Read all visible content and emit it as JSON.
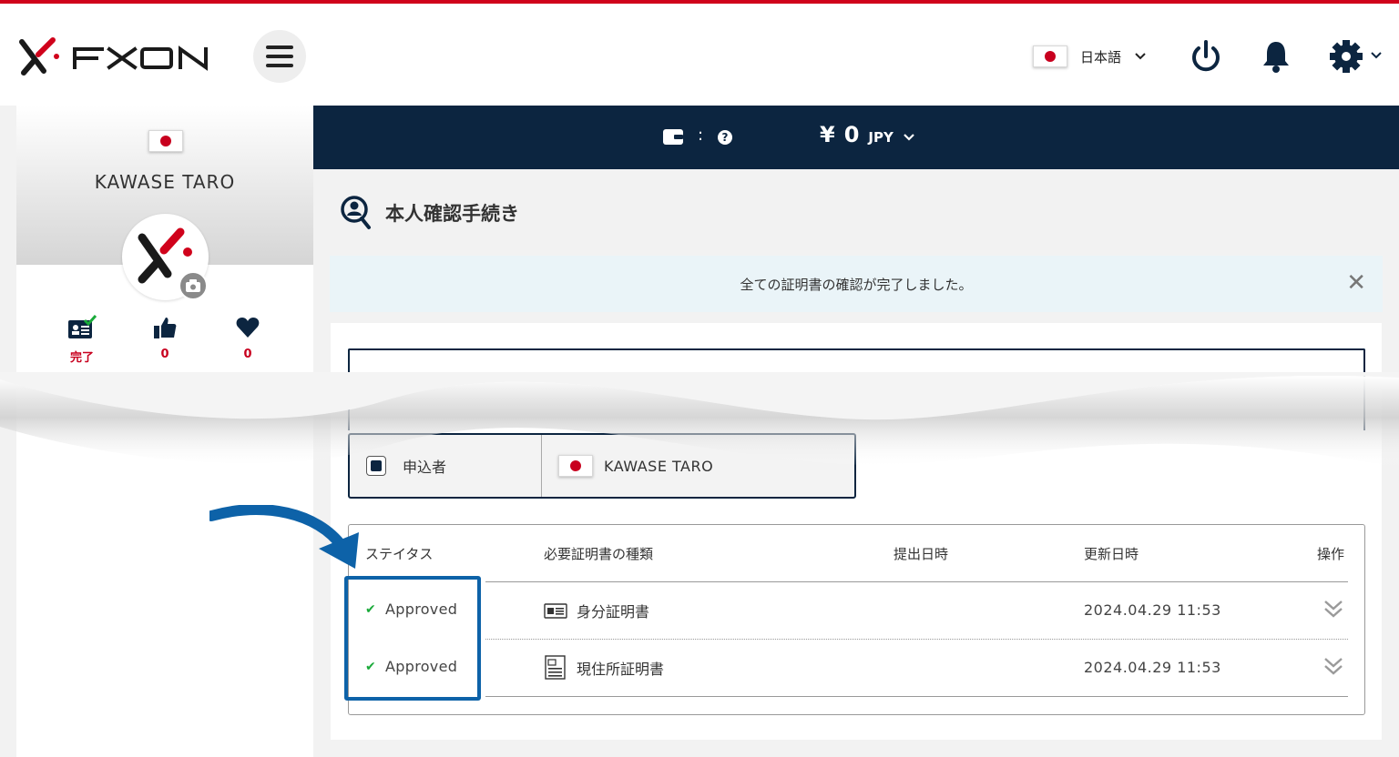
{
  "header": {
    "brand": "FXON",
    "language": "日本語"
  },
  "balance": {
    "colon": ":",
    "help": "?",
    "currency_symbol": "¥",
    "amount": "0",
    "currency": "JPY"
  },
  "sidebar": {
    "user_name": "KAWASE TARO",
    "stats": [
      {
        "icon": "id-card-check-icon",
        "value": "完了"
      },
      {
        "icon": "thumbs-up-icon",
        "value": "0"
      },
      {
        "icon": "heart-icon",
        "value": "0"
      }
    ]
  },
  "page": {
    "title": "本人確認手続き",
    "alert": "全ての証明書の確認が完了しました。",
    "alert_close": "✕"
  },
  "applicant": {
    "label": "申込者",
    "name": "KAWASE TARO"
  },
  "table": {
    "headers": [
      "ステイタス",
      "必要証明書の種類",
      "提出日時",
      "更新日時",
      "操作"
    ],
    "rows": [
      {
        "status": "Approved",
        "document": "身分証明書",
        "submitted": "",
        "updated": "2024.04.29 11:53"
      },
      {
        "status": "Approved",
        "document": "現住所証明書",
        "submitted": "",
        "updated": "2024.04.29 11:53"
      }
    ]
  },
  "colors": {
    "brand_red": "#d0021b",
    "navy": "#0c2540",
    "highlight_blue": "#0d62a8",
    "approved_green": "#1aaa3a"
  }
}
